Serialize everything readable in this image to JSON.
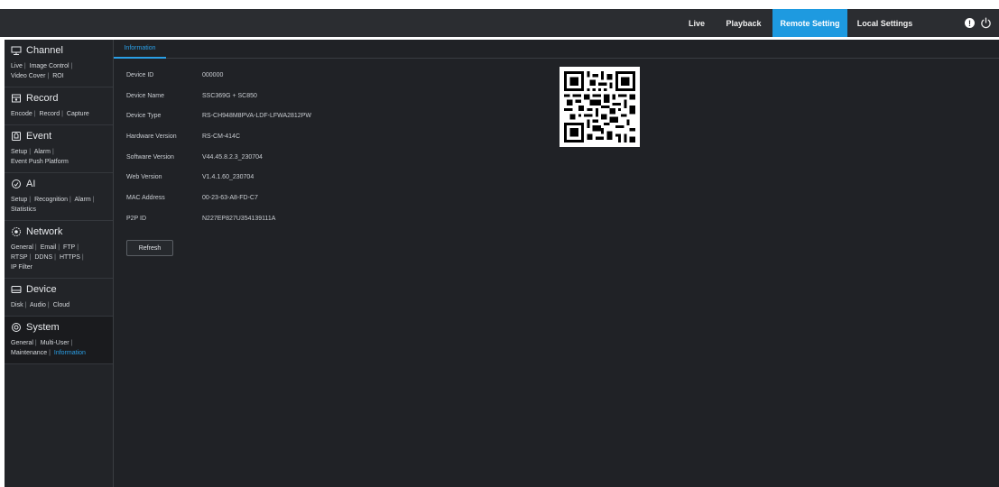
{
  "topnav": {
    "items": [
      {
        "label": "Live"
      },
      {
        "label": "Playback"
      },
      {
        "label": "Remote Setting"
      },
      {
        "label": "Local Settings"
      }
    ],
    "active_index": 2,
    "info_icon": "info-icon",
    "power_icon": "power-icon"
  },
  "sidebar": {
    "sections": [
      {
        "title": "Channel",
        "icon": "monitor-icon",
        "links": [
          "Live",
          "Image Control",
          "Video Cover",
          "ROI"
        ]
      },
      {
        "title": "Record",
        "icon": "record-icon",
        "links": [
          "Encode",
          "Record",
          "Capture"
        ]
      },
      {
        "title": "Event",
        "icon": "event-icon",
        "links": [
          "Setup",
          "Alarm",
          "Event Push Platform"
        ]
      },
      {
        "title": "AI",
        "icon": "ai-icon",
        "links": [
          "Setup",
          "Recognition",
          "Alarm",
          "Statistics"
        ]
      },
      {
        "title": "Network",
        "icon": "network-icon",
        "links": [
          "General",
          "Email",
          "FTP",
          "RTSP",
          "DDNS",
          "HTTPS",
          "IP Filter"
        ]
      },
      {
        "title": "Device",
        "icon": "device-icon",
        "links": [
          "Disk",
          "Audio",
          "Cloud"
        ]
      },
      {
        "title": "System",
        "icon": "gear-icon",
        "links": [
          "General",
          "Multi-User",
          "Maintenance",
          "Information"
        ]
      }
    ],
    "active_section": "System",
    "active_link": "Information"
  },
  "main": {
    "tab_label": "Information",
    "fields": [
      {
        "label": "Device ID",
        "value": "000000"
      },
      {
        "label": "Device Name",
        "value": "SSC369G + SC850"
      },
      {
        "label": "Device Type",
        "value": "RS-CH948M8PVA-LDF-LFWA2812PW"
      },
      {
        "label": "Hardware Version",
        "value": "RS-CM-414C"
      },
      {
        "label": "Software Version",
        "value": "V44.45.8.2.3_230704"
      },
      {
        "label": "Web Version",
        "value": "V1.4.1.60_230704"
      },
      {
        "label": "MAC Address",
        "value": "00-23-63-A8-FD-C7"
      },
      {
        "label": "P2P ID",
        "value": "N227EP827U354139111A"
      }
    ],
    "refresh_label": "Refresh",
    "qr_icon": "qr-code"
  },
  "colors": {
    "accent": "#1e9ae0",
    "topbar": "#2b2d31",
    "sidebar": "#222428",
    "main": "#202226"
  }
}
